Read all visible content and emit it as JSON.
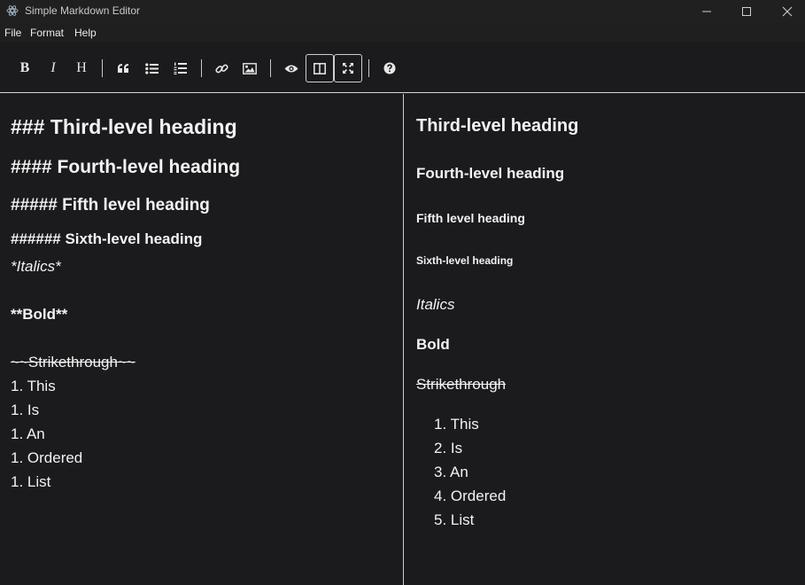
{
  "window": {
    "title": "Simple Markdown Editor",
    "controls": {
      "minimize_icon": "minimize-icon",
      "maximize_icon": "maximize-icon",
      "close_icon": "close-icon"
    }
  },
  "menu": {
    "items": [
      {
        "label": "File"
      },
      {
        "label": "Format"
      },
      {
        "label": "Help"
      }
    ]
  },
  "toolbar": {
    "bold_label": "B",
    "italic_label": "I",
    "heading_label": "H",
    "buttons": [
      "bold",
      "italic",
      "heading",
      "quote",
      "unordered-list",
      "ordered-list",
      "link",
      "image",
      "preview",
      "side-by-side",
      "fullscreen",
      "guide"
    ],
    "active": [
      "side-by-side",
      "fullscreen"
    ]
  },
  "editor": {
    "lines": [
      "### Third-level heading",
      "#### Fourth-level heading",
      "##### Fifth level heading",
      "###### Sixth-level heading",
      "*Italics*",
      "**Bold**",
      "~~Strikethrough~~",
      "1. This",
      "1. Is",
      "1. An",
      "1. Ordered",
      "1. List"
    ]
  },
  "preview": {
    "h3": "Third-level heading",
    "h4": "Fourth-level heading",
    "h5": "Fifth level heading",
    "h6": "Sixth-level heading",
    "italic": "Italics",
    "bold": "Bold",
    "strike": "Strikethrough",
    "list": [
      {
        "num": "1.",
        "text": "This"
      },
      {
        "num": "2.",
        "text": "Is"
      },
      {
        "num": "3.",
        "text": "An"
      },
      {
        "num": "4.",
        "text": "Ordered"
      },
      {
        "num": "5.",
        "text": "List"
      }
    ]
  },
  "colors": {
    "background": "#1b1b1d",
    "titlebar": "#202020",
    "text": "#f2f2f2",
    "divider": "#d0d0d0"
  }
}
